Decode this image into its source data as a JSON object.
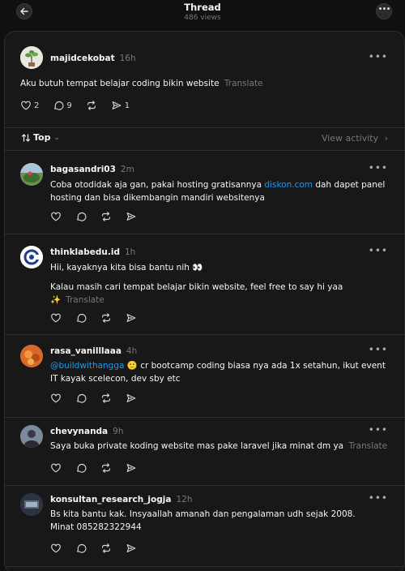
{
  "header": {
    "title": "Thread",
    "subtitle": "486 views"
  },
  "op": {
    "username": "majidcekobat",
    "time": "16h",
    "text": "Aku butuh tempat belajar coding bikin website",
    "translate": "Translate",
    "likes": "2",
    "comments": "9",
    "shares": "1"
  },
  "sort": {
    "label": "Top",
    "activity": "View activity"
  },
  "replies": [
    {
      "username": "bagasandri03",
      "time": "2m",
      "line1_a": "Coba otodidak aja gan, pakai hosting gratisannya ",
      "link": "diskon.com",
      "line1_b": " dah dapet panel",
      "line2": "hosting dan bisa dikembangin mandiri websitenya"
    },
    {
      "username": "thinklabedu.id",
      "time": "1h",
      "line1": "Hii, kayaknya kita bisa bantu nih 👀",
      "line2": "Kalau masih cari tempat belajar bikin website, feel free to say hi yaa",
      "line3": "✨",
      "translate": "Translate"
    },
    {
      "username": "rasa_vanilllaaa",
      "time": "4h",
      "mention": "@buildwithangga",
      "line1": " 🙂 cr bootcamp coding biasa nya ada 1x setahun, ikut event",
      "line2": "IT kayak scelecon, dev sby etc"
    },
    {
      "username": "chevynanda",
      "time": "9h",
      "line1": "Saya buka private koding website mas pake laravel jika minat dm ya",
      "translate": "Translate"
    },
    {
      "username": "konsultan_research_jogja",
      "time": "12h",
      "line1": "Bs kita bantu kak. Insyaallah amanah dan pengalaman udh sejak 2008.",
      "line2": "Minat 085282322944"
    }
  ]
}
